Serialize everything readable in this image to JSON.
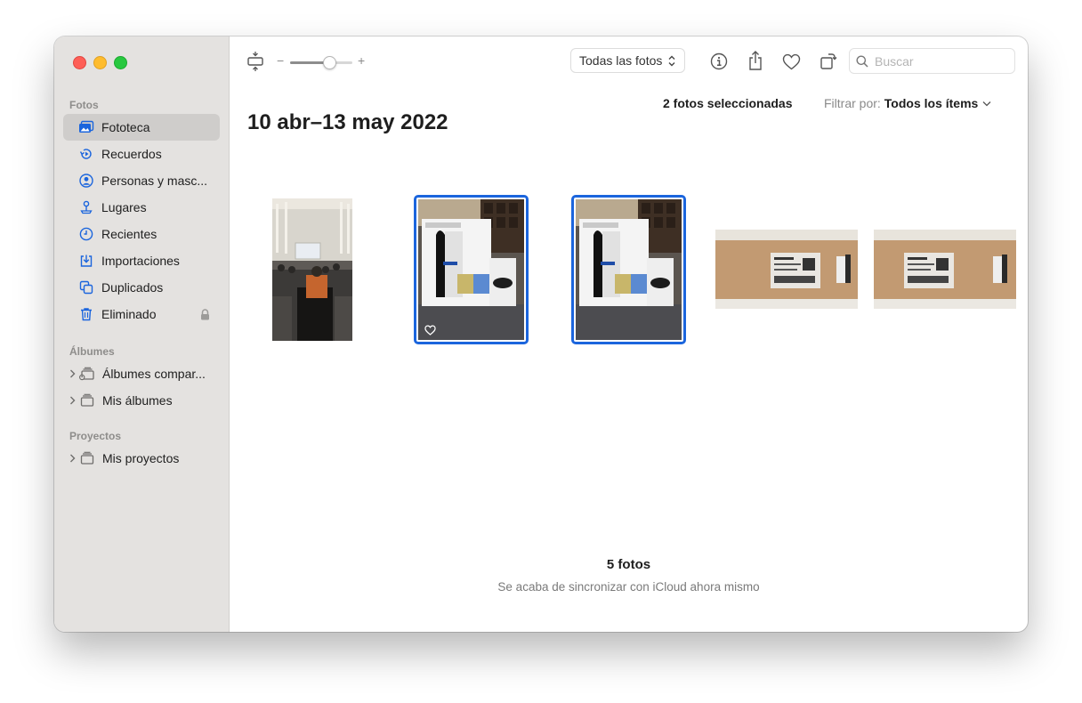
{
  "sidebar": {
    "sections": {
      "fotos": "Fotos",
      "albumes": "Álbumes",
      "proyectos": "Proyectos"
    },
    "items": [
      {
        "label": "Fototeca",
        "icon": "photo-library-icon",
        "selected": true
      },
      {
        "label": "Recuerdos",
        "icon": "memories-icon"
      },
      {
        "label": "Personas y masc...",
        "icon": "people-icon"
      },
      {
        "label": "Lugares",
        "icon": "places-pin-icon"
      },
      {
        "label": "Recientes",
        "icon": "clock-icon"
      },
      {
        "label": "Importaciones",
        "icon": "import-icon"
      },
      {
        "label": "Duplicados",
        "icon": "duplicates-icon"
      },
      {
        "label": "Eliminado",
        "icon": "trash-icon",
        "locked": true
      }
    ],
    "albums": [
      {
        "label": "Álbumes compar...",
        "icon": "shared-albums-icon"
      },
      {
        "label": "Mis álbumes",
        "icon": "albums-stack-icon"
      }
    ],
    "projects": [
      {
        "label": "Mis proyectos",
        "icon": "projects-stack-icon"
      }
    ]
  },
  "toolbar": {
    "zoom_minus": "−",
    "zoom_plus": "+",
    "zoom_level": 0.62,
    "view_select": "Todas las fotos",
    "search_placeholder": "Buscar"
  },
  "content": {
    "selected_count": "2 fotos seleccionadas",
    "filter_label": "Filtrar por:",
    "filter_value": "Todos los ítems",
    "date_range": "10 abr–13 may 2022",
    "photos": [
      {
        "subject": "conference-room",
        "selected": false
      },
      {
        "subject": "ps5-box",
        "selected": true,
        "favorite": true
      },
      {
        "subject": "ps5-box",
        "selected": true,
        "favorite": false
      },
      {
        "subject": "cardboard-box",
        "selected": false
      },
      {
        "subject": "cardboard-box",
        "selected": false
      }
    ],
    "footer_count": "5 fotos",
    "footer_sync": "Se acaba de sincronizar con iCloud ahora mismo"
  },
  "colors": {
    "accent": "#1b65dd",
    "sidebar_bg": "#e4e2e0",
    "sidebar_selected": "#cfcdcb"
  }
}
